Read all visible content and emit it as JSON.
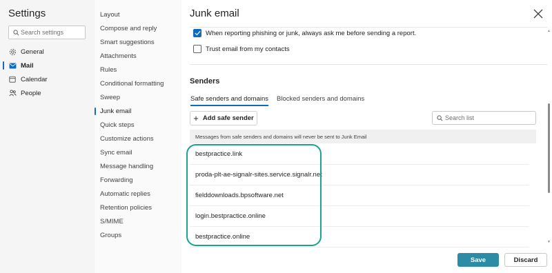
{
  "left_pane": {
    "title": "Settings",
    "search_placeholder": "Search settings",
    "categories": [
      {
        "label": "General",
        "icon": "gear-icon"
      },
      {
        "label": "Mail",
        "icon": "mail-icon",
        "active": true
      },
      {
        "label": "Calendar",
        "icon": "calendar-icon"
      },
      {
        "label": "People",
        "icon": "people-icon"
      }
    ]
  },
  "middle_pane": {
    "items": [
      "Layout",
      "Compose and reply",
      "Smart suggestions",
      "Attachments",
      "Rules",
      "Conditional formatting",
      "Sweep",
      "Junk email",
      "Quick steps",
      "Customize actions",
      "Sync email",
      "Message handling",
      "Forwarding",
      "Automatic replies",
      "Retention policies",
      "S/MIME",
      "Groups"
    ],
    "active_index": 7
  },
  "main": {
    "title": "Junk email",
    "options": [
      {
        "label": "When reporting phishing or junk, always ask me before sending a report.",
        "checked": true
      },
      {
        "label": "Trust email from my contacts",
        "checked": false
      }
    ],
    "senders_heading": "Senders",
    "tabs": [
      {
        "label": "Safe senders and domains",
        "active": true
      },
      {
        "label": "Blocked senders and domains",
        "active": false
      }
    ],
    "add_button_label": "Add safe sender",
    "list_search_placeholder": "Search list",
    "info_banner": "Messages from safe senders and domains will never be sent to Junk Email",
    "senders": [
      "bestpractice.link",
      "proda-plt-ae-signalr-sites.service.signalr.net",
      "fielddownloads.bpsoftware.net",
      "login.bestpractice.online",
      "bestpractice.online"
    ],
    "save_label": "Save",
    "discard_label": "Discard"
  },
  "colors": {
    "accent": "#0f6cbd",
    "save_button": "#2c8ca6",
    "highlight": "#18a38f"
  }
}
